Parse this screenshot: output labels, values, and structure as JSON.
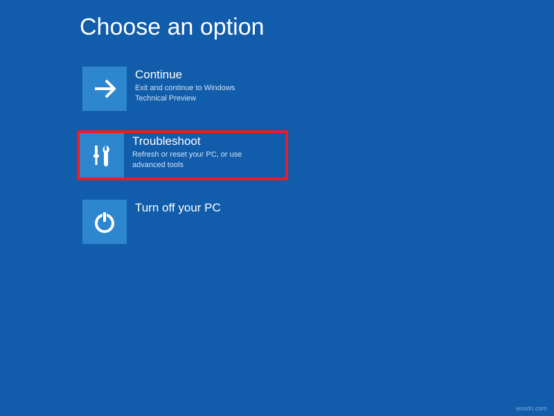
{
  "page": {
    "title": "Choose an option"
  },
  "options": {
    "continue": {
      "title": "Continue",
      "desc": "Exit and continue to Windows Technical Preview"
    },
    "troubleshoot": {
      "title": "Troubleshoot",
      "desc": "Refresh or reset your PC, or use advanced tools"
    },
    "turnoff": {
      "title": "Turn off your PC",
      "desc": ""
    }
  },
  "watermark": "wsxdn.com",
  "colors": {
    "background": "#115cab",
    "tile": "#2e87ce",
    "highlight": "#ed1c24"
  }
}
